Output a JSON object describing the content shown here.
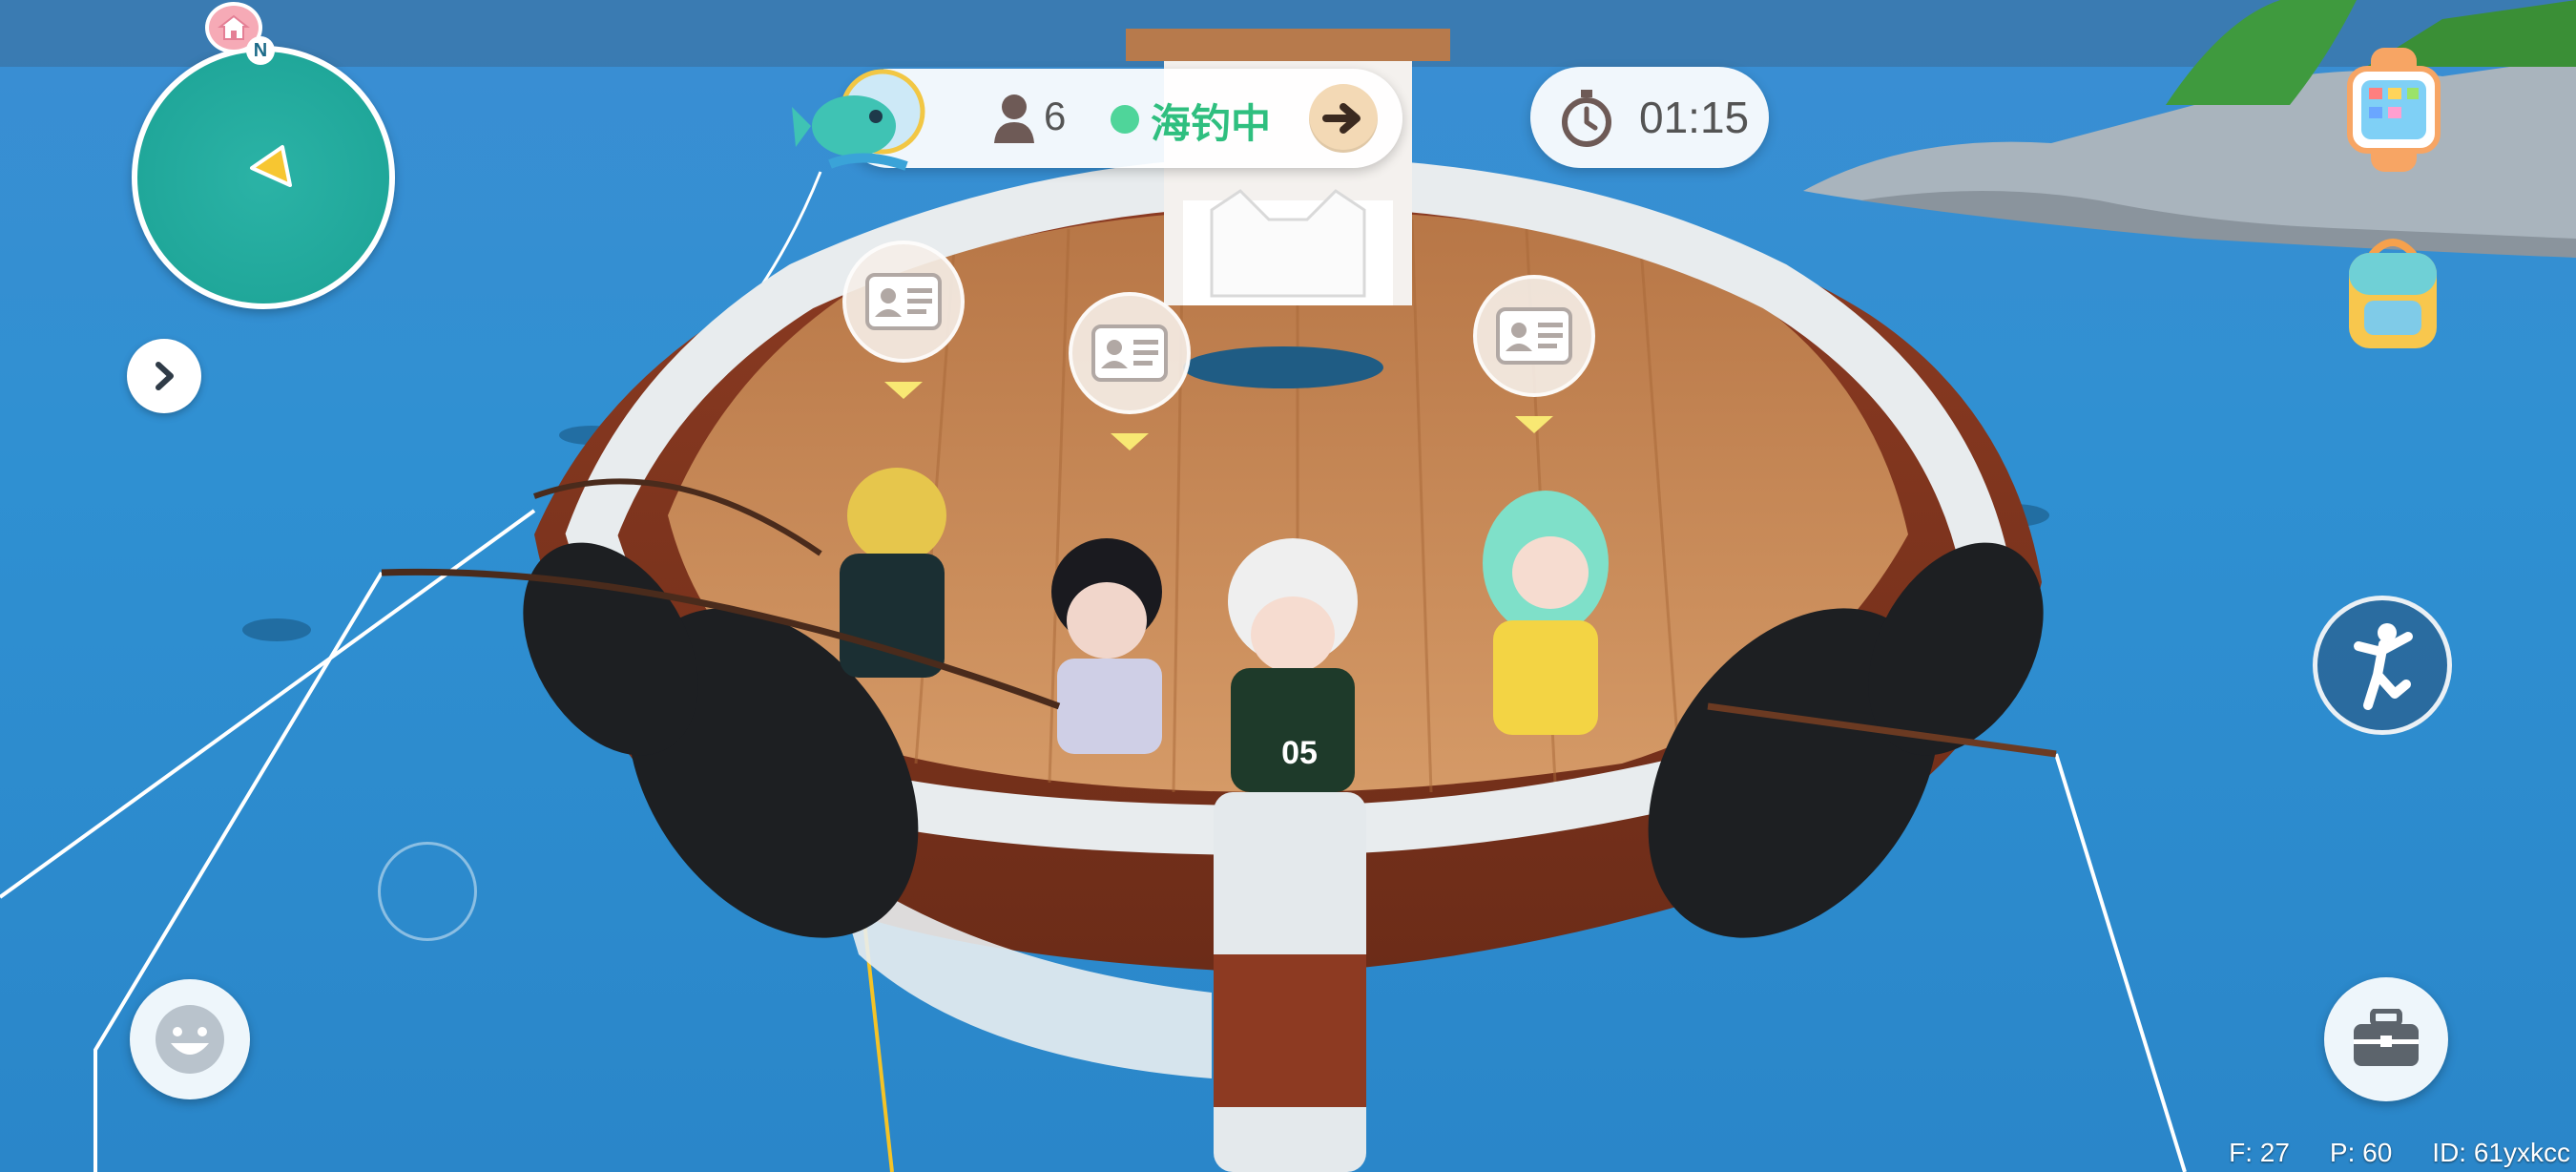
{
  "hud": {
    "minimap": {
      "north_label": "N",
      "marker_color": "#f7c631",
      "map_color": "#20a79a"
    },
    "status_bar": {
      "player_count": "6",
      "activity_status": "海钓中",
      "status_color": "#2fbf7f"
    },
    "timer": {
      "time": "01:15"
    },
    "icons": {
      "home": "home-icon",
      "expand": "chevron-right-icon",
      "fish_activity": "fish-icon",
      "players": "person-icon",
      "go": "arrow-right-icon",
      "timer": "stopwatch-icon",
      "watch": "smartwatch-icon",
      "backpack": "backpack-icon",
      "action": "dance-pose-icon",
      "toolbox": "toolbox-icon",
      "emoji": "smile-icon"
    }
  },
  "players": [
    {
      "marker": "profile-card"
    },
    {
      "marker": "profile-card"
    },
    {
      "marker": "profile-card"
    }
  ],
  "scene": {
    "water_color": "#2f8fcf",
    "boat_deck_color": "#c68a57",
    "boat_hull_color": "#8a3a22",
    "jersey_number": "05"
  },
  "debug": {
    "fps": "F: 27",
    "ping": "P: 60",
    "id": "ID: 61yxkcc"
  }
}
